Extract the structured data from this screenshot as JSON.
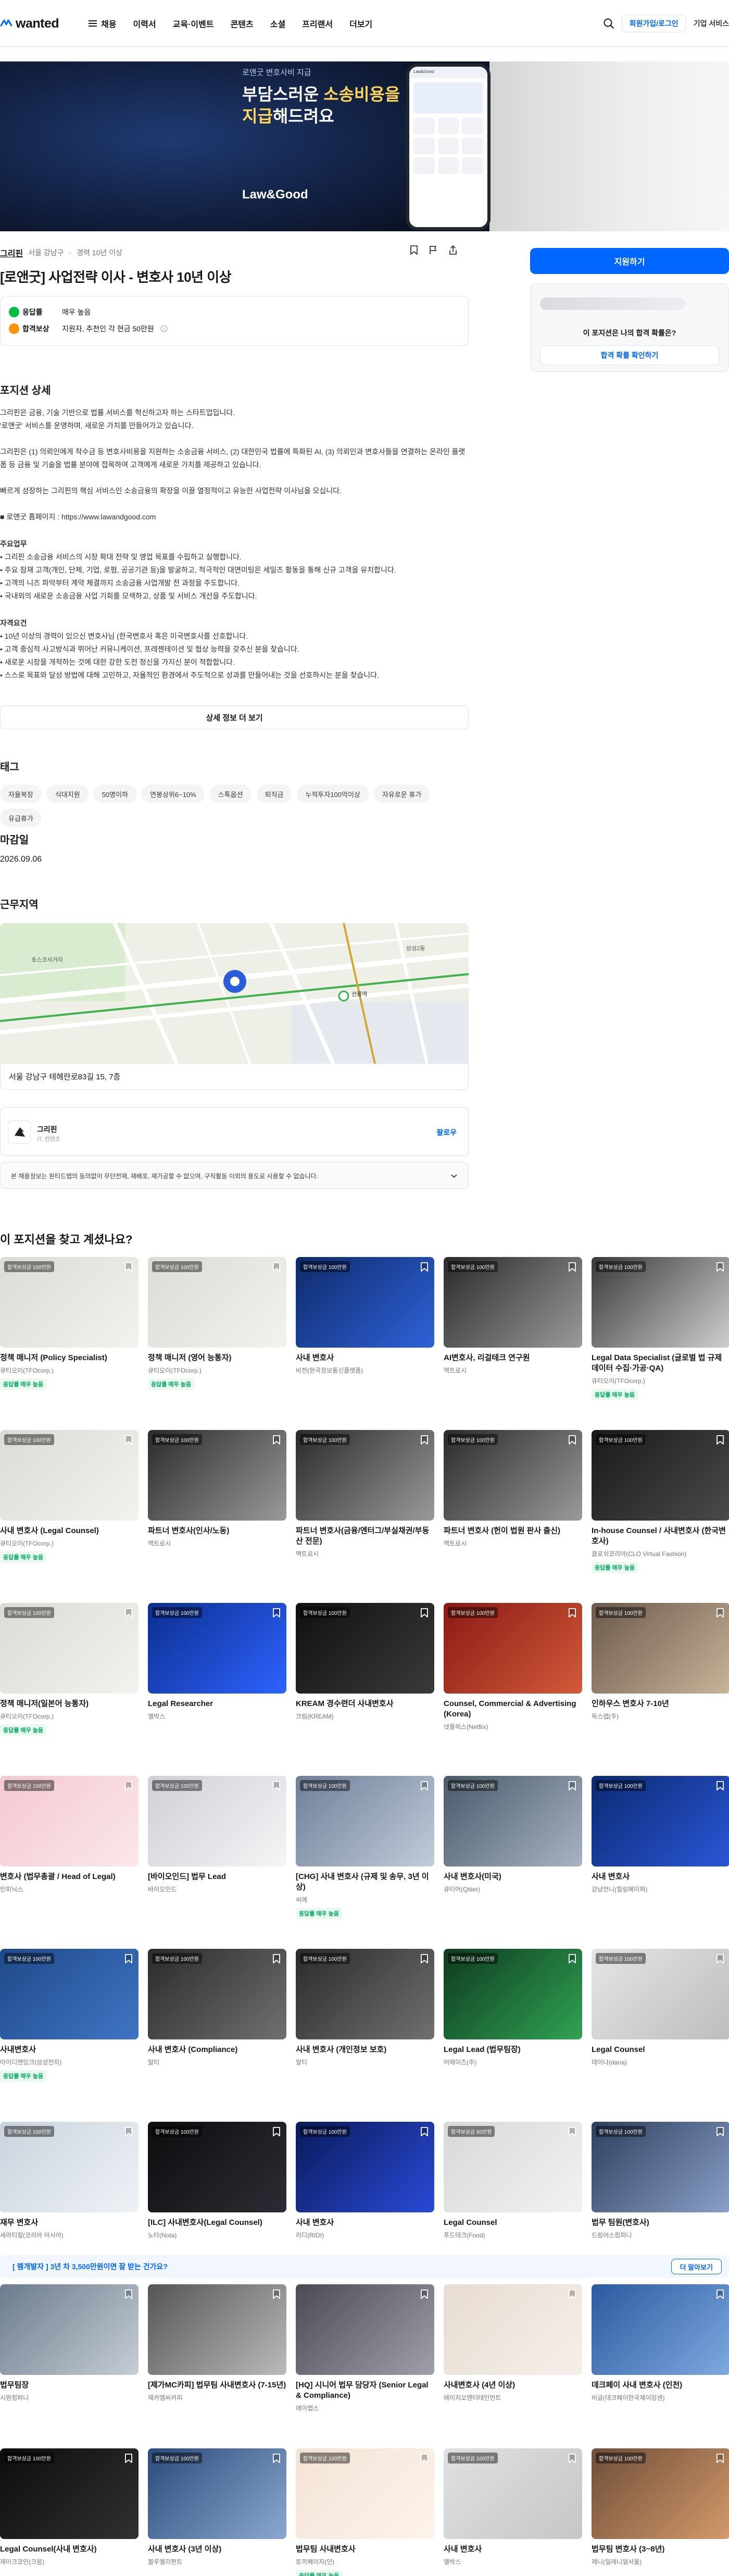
{
  "header": {
    "logo": "wanted",
    "nav": [
      {
        "label": "채용",
        "icon": "hamburger-menu-icon"
      },
      {
        "label": "이력서"
      },
      {
        "label": "교육·이벤트"
      },
      {
        "label": "콘텐츠"
      },
      {
        "label": "소셜"
      },
      {
        "label": "프리랜서"
      },
      {
        "label": "더보기"
      }
    ],
    "signup_login": "회원가입/로그인",
    "enterprise": "기업 서비스"
  },
  "hero": {
    "subtitle": "로앤굿 변호사비 지급",
    "title_line1": "부담스러운 ",
    "title_hl1": "소송비용을",
    "title_hl2": "지급",
    "title_line2": "해드려요",
    "brand": "Law&Good"
  },
  "job": {
    "company": "그리핀",
    "location": "서울 강남구",
    "experience": "경력 10년 이상",
    "title": "[로앤굿] 사업전략 이사 - 변호사 10년 이상",
    "response_label": "응답률",
    "response_value": "매우 높음",
    "reward_label": "합격보상",
    "reward_value": "지원자, 추천인 각 현금 50만원"
  },
  "detail": {
    "section_title": "포지션 상세",
    "p1": "그리핀은 금융, 기술 기반으로 법률 서비스를 혁신하고자 하는 스타트업입니다.",
    "p2": "'로앤굿' 서비스를 운영하며, 새로운 가치를 만들어가고 있습니다.",
    "p3": "그리핀은 (1) 의뢰인에게 착수금 등 변호사비용을 지원하는 소송금융 서비스, (2) 대한민국 법률에 특화된 AI, (3) 의뢰인과 변호사들을 연결하는 온라인 플랫폼 등 금융 및 기술을 법률 분야에 접목하여 고객에게 새로운 가치를 제공하고 있습니다.",
    "p4": "빠르게 성장하는 그리핀의 핵심 서비스인 소송금융의 확장을 이끌 열정적이고 유능한 사업전략 이사님을 모십니다.",
    "p5": "■ 로앤굿 홈페이지 : https://www.lawandgood.com",
    "duties_title": "주요업무",
    "duties": [
      "• 그리핀 소송금융 서비스의 시장 확대 전략 및 영업 목표를 수립하고 실행합니다.",
      "• 주요 잠재 고객(개인, 단체, 기업, 로펌, 공공기관 등)을 발굴하고, 적극적인 대면미팅은 세일즈 활동을 통해 신규 고객을 유치합니다.",
      "• 고객의 니즈 파악부터 계약 체결까지 소송금융 사업개발 전 과정을 주도합니다.",
      "• 국내외의 새로운 소송금융 사업 기회를 모색하고, 상품 및 서비스 개선을 주도합니다."
    ],
    "qual_title": "자격요건",
    "quals": [
      "• 10년 이상의 경력이 있으신 변호사님 (한국변호사 혹은 미국변호사를 선호합니다.",
      "• 고객 중심적 사고방식과 뛰어난 커뮤니케이션, 프레젠테이션 및 협상 능력을 갖추신 분을 찾습니다.",
      "• 새로운 시장을 개척하는 것에 대한 강한 도전 정신을 가지신 분이 적합합니다.",
      "• 스스로 목표와 달성 방법에 대해 고민하고, 자율적인 환경에서 주도적으로 성과를 만들어내는 것을 선호하시는 분을 찾습니다."
    ],
    "more_button": "상세 정보 더 보기"
  },
  "tags": {
    "title": "태그",
    "items": [
      "자율복장",
      "식대지원",
      "50명이하",
      "연봉상위6~10%",
      "스톡옵션",
      "퇴직금",
      "누적투자100억이상",
      "자유로운 휴가",
      "유급휴가"
    ]
  },
  "deadline": {
    "title": "마감일",
    "value": "2026.09.06"
  },
  "location": {
    "title": "근무지역",
    "address": "서울 강남구 테헤란로83길 15, 7층",
    "map_labels": [
      "선릉역",
      "삼성역",
      "KT&G 대치타워",
      "포스코사거리",
      "코엑스",
      "삼성2동"
    ]
  },
  "company_card": {
    "name": "그리핀",
    "sub": "IT, 컨텐츠",
    "follow": "팔로우"
  },
  "notice": "본 채용정보는 원티드랩의 동의없이 무단전재, 재배포, 재가공할 수 없으며, 구직활동 이외의 용도로 사용할 수 없습니다.",
  "sidebar": {
    "apply": "지원하기",
    "question": "이 포지션은 나의 합격 확률은?",
    "check": "합격 확률 확인하기"
  },
  "recommend": {
    "title": "이 포지션을 찾고 계셨나요?",
    "reward_badge": "합격보상금 100만원",
    "reward_badge_alt": "합격보상금 50만원",
    "resp_label": "응답률 매우 높음",
    "cards": [
      {
        "title": "정책 매니저 (Policy Specialist)",
        "company": "큐티오이(TFOcorp.)",
        "resp": true,
        "badge": "합격보상금 100만원",
        "thumb": "office"
      },
      {
        "title": "정책 매니저 (영어 능통자)",
        "company": "큐티오이(TFOcorp.)",
        "resp": true,
        "badge": "합격보상금 100만원",
        "thumb": "office"
      },
      {
        "title": "사내 변호사",
        "company": "비전(한국정보통신플랫폼)",
        "resp": false,
        "badge": "합격보상금 100만원",
        "thumb": "blue-ai"
      },
      {
        "title": "AI변호사, 리걸테크 연구원",
        "company": "액트로시",
        "resp": false,
        "badge": "합격보상금 100만원",
        "thumb": "keyboard"
      },
      {
        "title": "Legal Data Specialist (글로벌 법 규제 데이터 수집·가공·QA)",
        "company": "큐티오이(TFOcorp.)",
        "resp": true,
        "badge": "합격보상금 100만원",
        "thumb": "laptop"
      },
      {
        "title": "사내 변호사 (Legal Counsel)",
        "company": "큐티오이(TFOcorp.)",
        "resp": true,
        "badge": "합격보상금 100만원",
        "thumb": "office"
      },
      {
        "title": "파트너 변호사(인사/노동)",
        "company": "액트로시",
        "resp": false,
        "badge": "합격보상금 100만원",
        "thumb": "keyboard"
      },
      {
        "title": "파트너 변호사(금융/엔터그/부실채권/부동산 전문)",
        "company": "액트로시",
        "resp": false,
        "badge": "합격보상금 100만원",
        "thumb": "keyboard"
      },
      {
        "title": "파트너 변호사 (헌이 법원 판사 출신)",
        "company": "액트로시",
        "resp": false,
        "badge": "합격보상금 100만원",
        "thumb": "keyboard"
      },
      {
        "title": "In-house Counsel / 사내변호사 (한국변호사)",
        "company": "클로쉬코리아(CLO Virtual Fashion)",
        "resp": true,
        "badge": "합격보상금 100만원",
        "thumb": "clo"
      },
      {
        "title": "정책 매니저(일본어 능통자)",
        "company": "큐티오이(TFOcorp.)",
        "resp": true,
        "badge": "합격보상금 100만원",
        "thumb": "office"
      },
      {
        "title": "Legal Researcher",
        "company": "엘박스",
        "resp": false,
        "badge": "합격보상금 100만원",
        "thumb": "lbox"
      },
      {
        "title": "KREAM 경수련더 사내변호사",
        "company": "크림(KREAM)",
        "resp": false,
        "badge": "합격보상금 100만원",
        "thumb": "dark"
      },
      {
        "title": "Counsel, Commercial & Advertising (Korea)",
        "company": "넷플릭스(Netflix)",
        "resp": false,
        "badge": "합격보상금 100만원",
        "thumb": "netflix"
      },
      {
        "title": "인하우스 변호사 7-10년",
        "company": "독스랩(주)",
        "resp": false,
        "badge": "합격보상금 100만원",
        "thumb": "shop"
      },
      {
        "title": "변호사 (법무총괄 / Head of Legal)",
        "company": "인피닉스",
        "resp": false,
        "badge": "합격보상금 100만원",
        "thumb": "pink"
      },
      {
        "title": "[바이오인드] 법무 Lead",
        "company": "바이오인드",
        "resp": false,
        "badge": "합격보상금 100만원",
        "thumb": "paper"
      },
      {
        "title": "[CHG] 사내 변호사 (규제 및 송무, 3년 이상)",
        "company": "씨에",
        "resp": true,
        "badge": "합격보상금 100만원",
        "thumb": "building"
      },
      {
        "title": "사내 변호사(미국)",
        "company": "큐티어(Qitier)",
        "resp": false,
        "badge": "합격보상금 100만원",
        "thumb": "street"
      },
      {
        "title": "사내 변호사",
        "company": "강남언니(힐링페이퍼)",
        "resp": false,
        "badge": "합격보상금 100만원",
        "thumb": "gangnam"
      },
      {
        "title": "사내변호사",
        "company": "아이디엔잉크(삼성전자)",
        "resp": true,
        "badge": "합격보상금 100만원",
        "thumb": "samsung"
      },
      {
        "title": "사내 변호사 (Compliance)",
        "company": "알티",
        "resp": false,
        "badge": "합격보상금 100만원",
        "thumb": "alti"
      },
      {
        "title": "사내 변호사 (개인정보 보호)",
        "company": "알티",
        "resp": false,
        "badge": "합격보상금 100만원",
        "thumb": "alti"
      },
      {
        "title": "Legal Lead (법무팀장)",
        "company": "어메이즈(주)",
        "resp": false,
        "badge": "합격보상금 100만원",
        "thumb": "event"
      },
      {
        "title": "Legal Counsel",
        "company": "데이나(dana)",
        "resp": false,
        "badge": "합격보상금 100만원",
        "thumb": "phone"
      },
      {
        "title": "재무 변호사",
        "company": "세라티컬(코리아 아시아)",
        "resp": false,
        "badge": "합격보상금 100만원",
        "thumb": "cafe"
      },
      {
        "title": "[ILC] 사내변호사(Legal Counsel)",
        "company": "노타(Nota)",
        "resp": false,
        "badge": "합격보상금 100만원",
        "thumb": "nota"
      },
      {
        "title": "사내 변호사",
        "company": "리디(RIDI)",
        "resp": false,
        "badge": "합격보상금 100만원",
        "thumb": "ridi"
      },
      {
        "title": "Legal Counsel",
        "company": "푸드테크(Food)",
        "resp": false,
        "badge": "합격보상금 50만원",
        "thumb": "glasses"
      },
      {
        "title": "법무 팀원(변호사)",
        "company": "드림어스컴퍼니",
        "resp": false,
        "badge": "합격보상금 100만원",
        "thumb": "dreamus"
      },
      {
        "title": "법무팀장",
        "company": "시원컴퍼니",
        "resp": false,
        "badge": "",
        "thumb": "coffee"
      },
      {
        "title": "[제가MC카피] 법무팀 사내변호사 (7-15년)",
        "company": "제카엠씨카피",
        "resp": false,
        "badge": "",
        "thumb": "people"
      },
      {
        "title": "[HQ] 시니어 법무 담당자 (Senior Legal & Compliance)",
        "company": "에이랩스",
        "resp": false,
        "badge": "",
        "thumb": "labs"
      },
      {
        "title": "사내변호사 (4년 이상)",
        "company": "에이치오엔터테인먼트",
        "resp": false,
        "badge": "",
        "thumb": "group"
      },
      {
        "title": "데크페이 사내 변호사 (인천)",
        "company": "비글(데크페이한국제이잉센)",
        "resp": false,
        "badge": "",
        "thumb": "crew"
      },
      {
        "title": "Legal Counsel(사내 변호사)",
        "company": "제이크코인(크몽)",
        "resp": false,
        "badge": "합격보상금 100만원",
        "thumb": "kmong"
      },
      {
        "title": "사내 변호사 (3년 이상)",
        "company": "블루엘리펀트",
        "resp": false,
        "badge": "합격보상금 100만원",
        "thumb": "elephant"
      },
      {
        "title": "법무팀 사내변호사",
        "company": "토끼페이지(인)",
        "resp": true,
        "badge": "합격보상금 100만원",
        "thumb": "anime"
      },
      {
        "title": "사내 변호사",
        "company": "엘박스",
        "resp": false,
        "badge": "합격보상금 100만원",
        "thumb": "desk"
      },
      {
        "title": "법무팀 변호사 (3~8년)",
        "company": "래니(밀레니얼서울)",
        "resp": false,
        "badge": "합격보상금 100만원",
        "thumb": "town"
      }
    ]
  },
  "banner": {
    "text": "[ 렘개발자 ] 3년 차 3,500만원이면 잘 받는 건가요?",
    "button": "더 알아보기"
  },
  "colors": {
    "brand": "#0066ff",
    "hero_bg": "#101b33",
    "highlight": "#ffd75e",
    "response_green": "#00a862"
  }
}
